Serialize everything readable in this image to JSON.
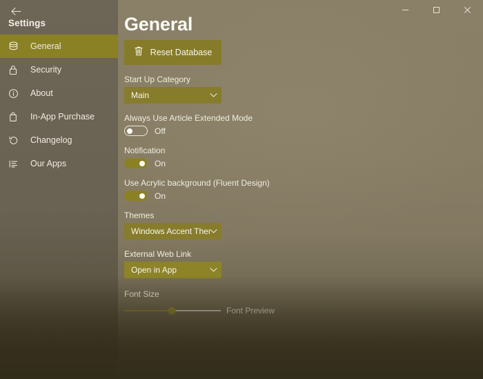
{
  "window": {
    "back_icon": "back-arrow-icon",
    "controls": {
      "minimize": "─",
      "maximize": "□",
      "close": "✕"
    }
  },
  "sidebar": {
    "title": "Settings",
    "items": [
      {
        "label": "General",
        "icon": "database-icon",
        "selected": true
      },
      {
        "label": "Security",
        "icon": "lock-icon",
        "selected": false
      },
      {
        "label": "About",
        "icon": "info-circle-icon",
        "selected": false
      },
      {
        "label": "In-App Purchase",
        "icon": "shopping-bag-icon",
        "selected": false
      },
      {
        "label": "Changelog",
        "icon": "history-icon",
        "selected": false
      },
      {
        "label": "Our Apps",
        "icon": "list-icon",
        "selected": false
      }
    ]
  },
  "main": {
    "page_title": "General",
    "reset_button": {
      "label": "Reset Database",
      "icon": "trash-icon"
    },
    "start_up_category": {
      "label": "Start Up Category",
      "value": "Main",
      "chevron": "chevron-down-icon"
    },
    "article_extended_mode": {
      "label": "Always Use Article Extended Mode",
      "state": "Off",
      "on": false
    },
    "notification": {
      "label": "Notification",
      "state": "On",
      "on": true
    },
    "acrylic_background": {
      "label": "Use Acrylic background (Fluent Design)",
      "state": "On",
      "on": true
    },
    "themes": {
      "label": "Themes",
      "value": "Windows Accent Theme",
      "chevron": "chevron-down-icon"
    },
    "external_web_link": {
      "label": "External Web Link",
      "value": "Open in App",
      "chevron": "chevron-down-icon"
    },
    "font_size": {
      "label": "Font Size",
      "percent": 49,
      "preview_text": "Font Preview"
    }
  },
  "colors": {
    "accent": "#8a8124",
    "window_background": "#847a62",
    "sidebar_background": "#6b6353",
    "text_primary": "#f2efe8"
  }
}
